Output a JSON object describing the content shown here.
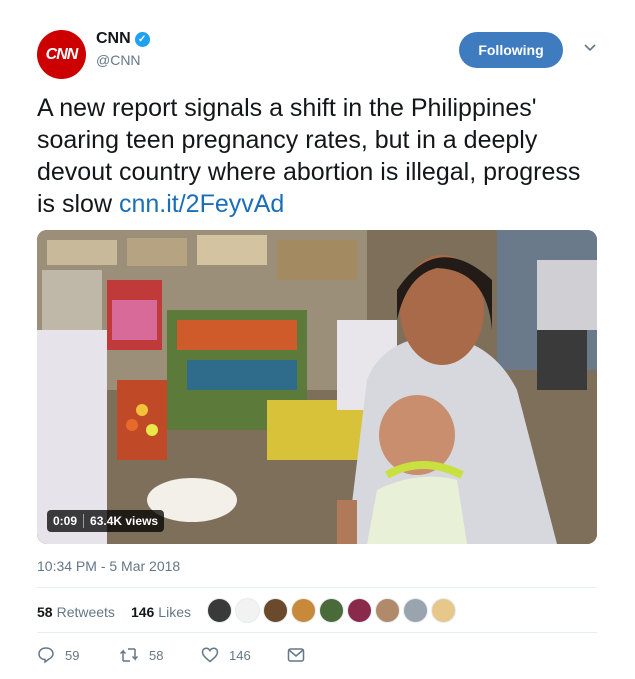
{
  "author": {
    "display_name": "CNN",
    "handle": "@CNN",
    "avatar_text": "CNN",
    "avatar_color": "#cc0000",
    "verified": true
  },
  "follow_button": {
    "label": "Following"
  },
  "tweet": {
    "text": "A new report signals a shift in the Philippines' soaring teen pregnancy rates, but in a deeply devout country where abortion is illegal, progress is slow ",
    "link": "cnn.it/2FeyvAd"
  },
  "video": {
    "time": "0:09",
    "views": "63.4K views"
  },
  "timestamp": "10:34 PM - 5 Mar 2018",
  "stats": {
    "retweets_count": "58",
    "retweets_label": "Retweets",
    "likes_count": "146",
    "likes_label": "Likes"
  },
  "actions": {
    "replies": "59",
    "retweets": "58",
    "likes": "146"
  }
}
